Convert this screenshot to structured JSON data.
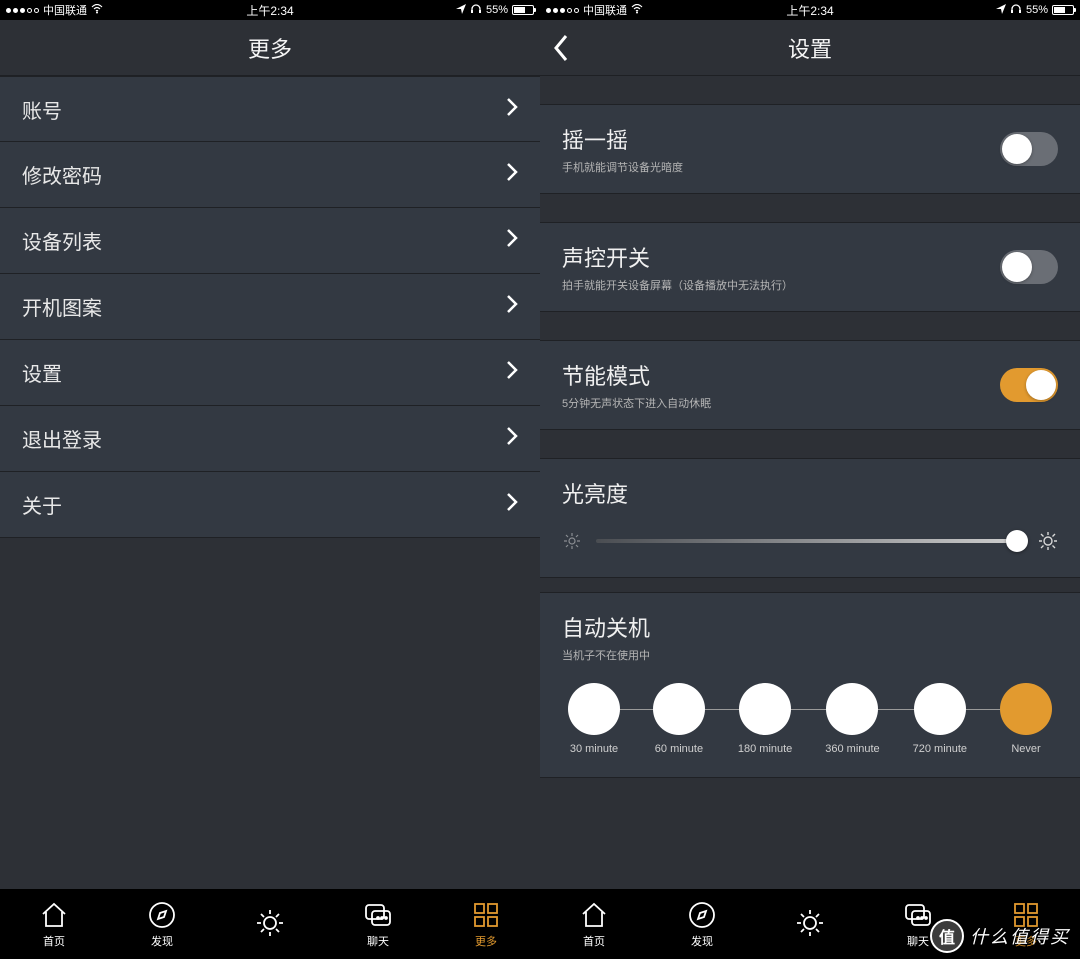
{
  "statusbar": {
    "carrier": "中国联通",
    "time": "上午2:34",
    "battery_pct": "55%"
  },
  "left": {
    "title": "更多",
    "menu": [
      {
        "label": "账号"
      },
      {
        "label": "修改密码"
      },
      {
        "label": "设备列表"
      },
      {
        "label": "开机图案"
      },
      {
        "label": "设置"
      },
      {
        "label": "退出登录"
      },
      {
        "label": "关于"
      }
    ]
  },
  "right": {
    "title": "设置",
    "toggles": [
      {
        "title": "摇一摇",
        "subtitle": "手机就能调节设备光暗度",
        "on": false
      },
      {
        "title": "声控开关",
        "subtitle": "拍手就能开关设备屏幕（设备播放中无法执行）",
        "on": false
      },
      {
        "title": "节能模式",
        "subtitle": "5分钟无声状态下进入自动休眠",
        "on": true
      }
    ],
    "brightness": {
      "title": "光亮度",
      "value_pct": 100
    },
    "auto_off": {
      "title": "自动关机",
      "subtitle": "当机子不在使用中",
      "options": [
        "30 minute",
        "60 minute",
        "180 minute",
        "360 minute",
        "720 minute",
        "Never"
      ],
      "selected_index": 5
    }
  },
  "tabs": [
    {
      "label": "首页"
    },
    {
      "label": "发现"
    },
    {
      "label": ""
    },
    {
      "label": "聊天"
    },
    {
      "label": "更多"
    }
  ],
  "active_tab_index": 4,
  "watermark": {
    "badge": "值",
    "text": "什么值得买"
  }
}
